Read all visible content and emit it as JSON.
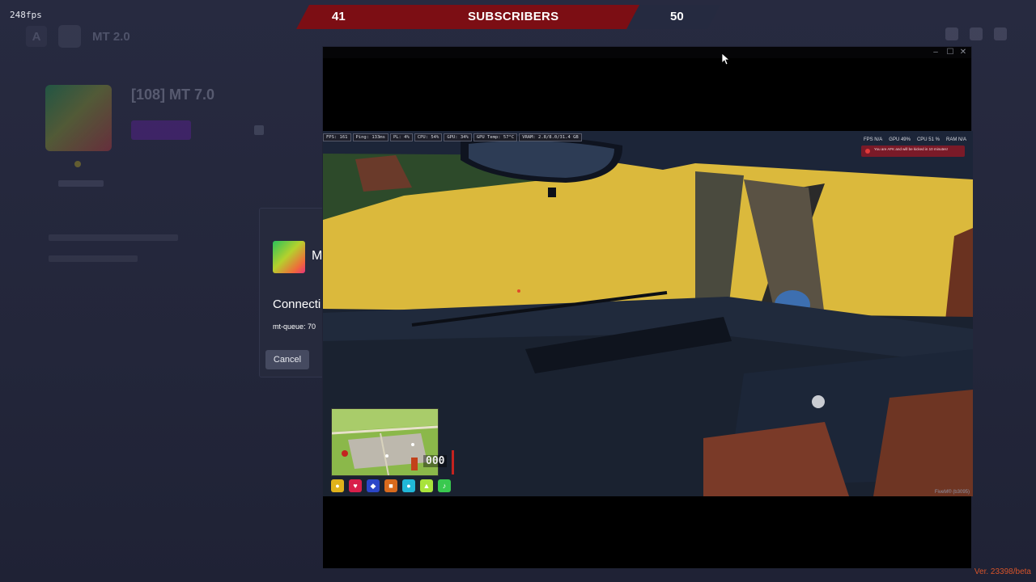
{
  "fps_counter": "248fps",
  "launcher": {
    "nav_title": "MT 2.0",
    "nav_logo": "A",
    "server_title": "[108] MT 7.0"
  },
  "scoreboard": {
    "left_value": "41",
    "title": "SUBSCRIBERS",
    "right_value": "50",
    "left_color": "#7c0e14",
    "right_color": "#252a40"
  },
  "dialog": {
    "title": "M",
    "status": "Connecti",
    "queue": "mt-queue: 70",
    "cancel_label": "Cancel"
  },
  "game_window": {
    "controls": {
      "minimize": "–",
      "maximize": "☐",
      "close": "✕"
    },
    "stats_bar": [
      "FPS: 161",
      "Ping: 133ms",
      "PL: 4%",
      "CPU: 54%",
      "GPU: 34%",
      "GPU Temp: 57°C",
      "VRAM: 2.8/8.0/31.4 GB"
    ],
    "right_stats": [
      "FPS N/A",
      "GPU 49%",
      "CPU 51 %",
      "RAM N/A"
    ],
    "afk_notice": "You are AFK and will be kicked in 10 minutes!",
    "watermark": "FiveM® (b3095)",
    "speed": "000",
    "hud_icons": [
      "gold-icon",
      "health-icon",
      "armor-icon",
      "hunger-icon",
      "water-icon",
      "stamina-icon",
      "voice-icon"
    ],
    "hud_colors": [
      "#e0b21b",
      "#d81f4a",
      "#2b46c8",
      "#d86a1d",
      "#21b7d8",
      "#a9e33b",
      "#39c94f"
    ]
  },
  "version": "Ver. 23398/beta"
}
